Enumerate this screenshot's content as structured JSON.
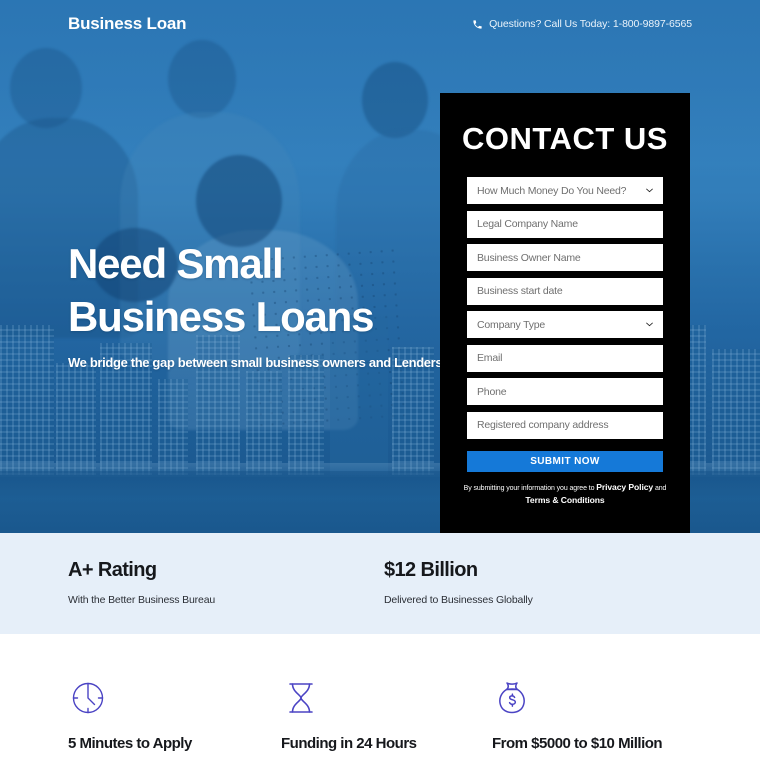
{
  "header": {
    "logo": "Business Loan",
    "phone_icon": "phone-icon",
    "phone_text": "Questions? Call Us Today: 1-800-9897-6565"
  },
  "hero": {
    "headline_line1": "Need Small",
    "headline_line2": "Business Loans",
    "subheadline": "We bridge the gap between small business owners and Lenders."
  },
  "form": {
    "title": "CONTACT US",
    "fields": [
      {
        "name": "amount-needed",
        "placeholder": "How Much Money Do You Need?",
        "type": "select"
      },
      {
        "name": "legal-company-name",
        "placeholder": "Legal Company Name",
        "type": "text"
      },
      {
        "name": "business-owner-name",
        "placeholder": "Business Owner Name",
        "type": "text"
      },
      {
        "name": "business-start-date",
        "placeholder": "Business start date",
        "type": "text"
      },
      {
        "name": "company-type",
        "placeholder": "Company Type",
        "type": "select"
      },
      {
        "name": "email",
        "placeholder": "Email",
        "type": "text"
      },
      {
        "name": "phone",
        "placeholder": "Phone",
        "type": "text"
      },
      {
        "name": "registered-company-address",
        "placeholder": "Registered company address",
        "type": "text"
      }
    ],
    "submit_label": "SUBMIT NOW",
    "legal_prefix": "By submitting your information you agree to ",
    "legal_link_1": "Privacy Policy",
    "legal_conjunction": " and ",
    "legal_link_2": "Terms & Conditions"
  },
  "stats": [
    {
      "title": "A+ Rating",
      "description": "With the Better Business Bureau"
    },
    {
      "title": "$12 Billion",
      "description": "Delivered to Businesses Globally"
    }
  ],
  "features": [
    {
      "icon": "clock-icon",
      "label": "5 Minutes to Apply"
    },
    {
      "icon": "hourglass-icon",
      "label": "Funding in 24 Hours"
    },
    {
      "icon": "money-bag-icon",
      "label": "From $5000 to $10 Million"
    }
  ],
  "colors": {
    "hero_overlay": "#2b7cc0",
    "form_panel": "#000000",
    "submit_button": "#1579d8",
    "stats_band": "#e6eff9",
    "feature_icon": "#4b44c4",
    "text_dark": "#16181c"
  }
}
